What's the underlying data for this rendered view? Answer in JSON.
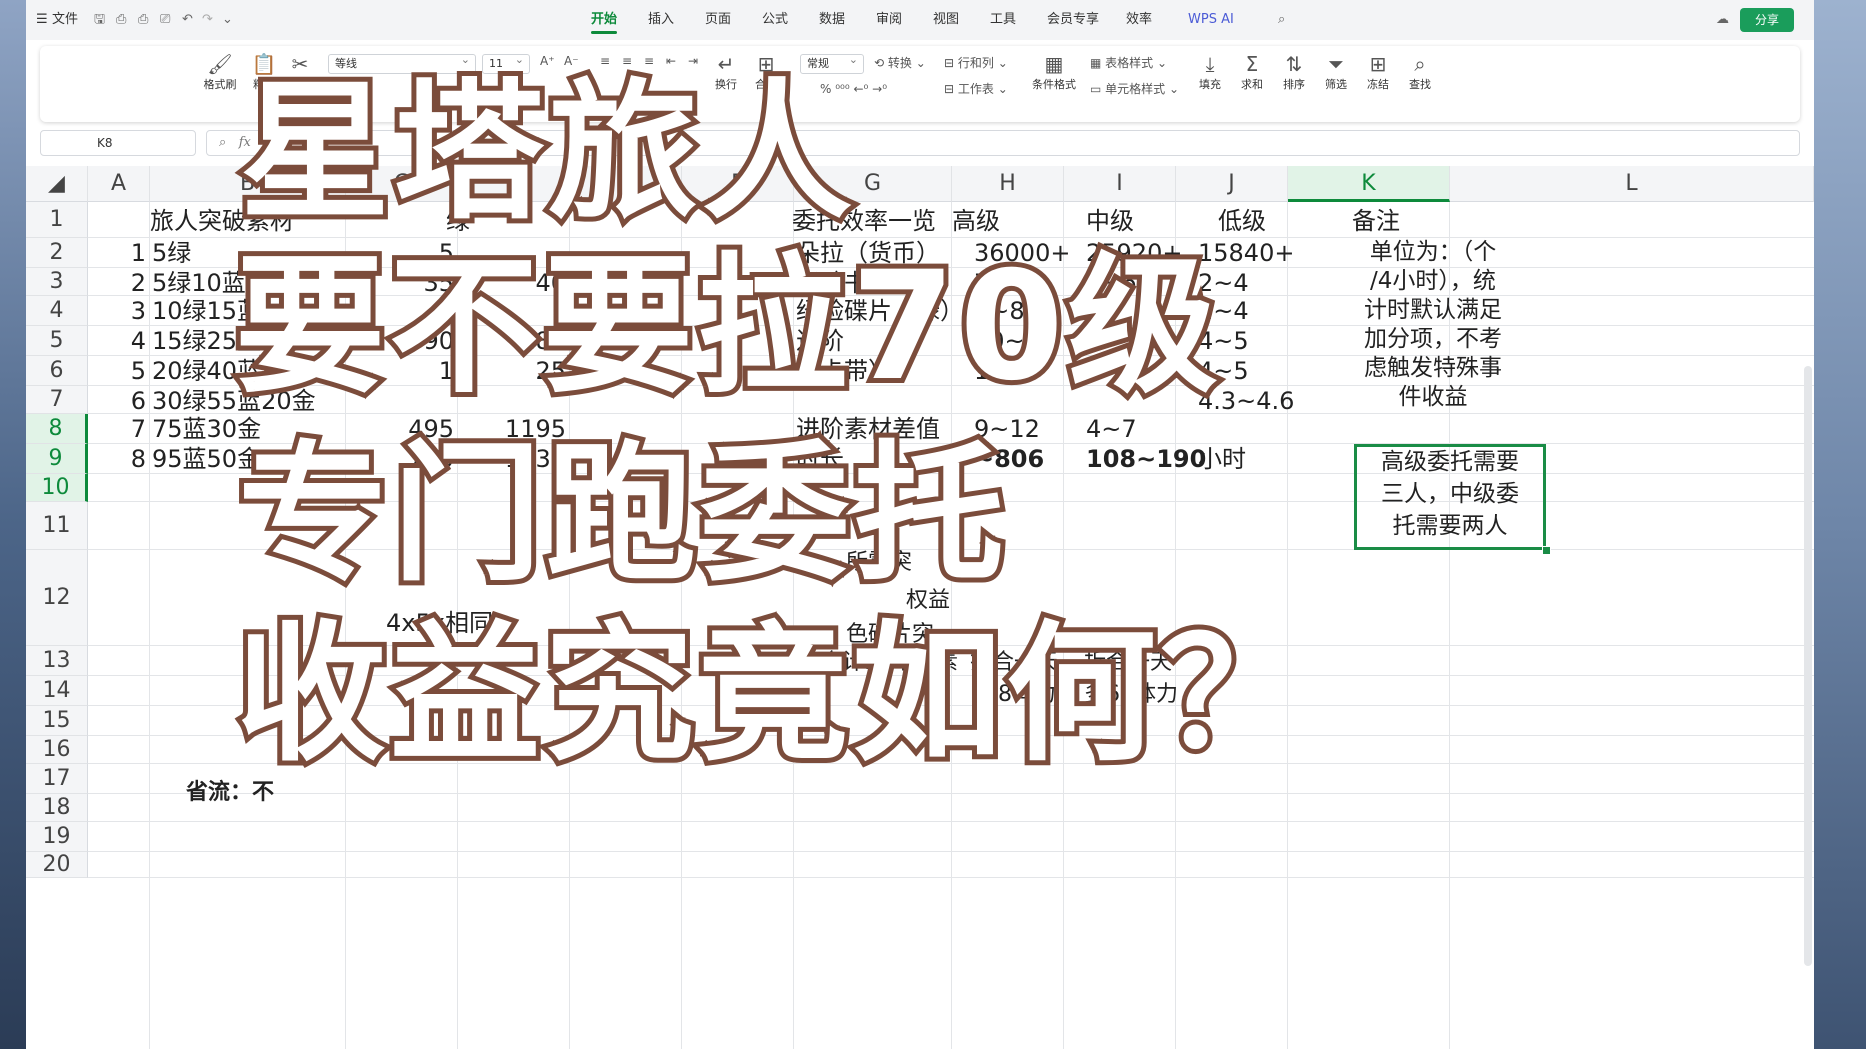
{
  "window": {
    "menu_file": "文件",
    "tabs": [
      {
        "label": "开始",
        "active": true
      },
      {
        "label": "插入"
      },
      {
        "label": "页面"
      },
      {
        "label": "公式"
      },
      {
        "label": "数据"
      },
      {
        "label": "审阅"
      },
      {
        "label": "视图"
      },
      {
        "label": "工具"
      },
      {
        "label": "会员专享"
      },
      {
        "label": "效率"
      },
      {
        "label": "WPS AI"
      }
    ],
    "share_label": "分享"
  },
  "ribbon": {
    "format_painter": "格式刷",
    "paste": "粘贴",
    "font_name": "等线",
    "font_size": "11",
    "wrap": "换行",
    "merge": "合并",
    "number_format": "常规",
    "convert": "转换",
    "row_col": "行和列",
    "sheet": "工作表",
    "table_style": "表格样式",
    "cond_format": "条件格式",
    "cell_style": "单元格样式",
    "fill": "填充",
    "sum": "求和",
    "sort": "排序",
    "filter": "筛选",
    "freeze": "冻结",
    "find": "查找"
  },
  "formula_bar": {
    "name_box": "K8",
    "fx": "fx",
    "content": "高"
  },
  "columns": [
    "A",
    "B",
    "C",
    "D",
    "E",
    "F",
    "G",
    "H",
    "I",
    "J",
    "K",
    "L"
  ],
  "rows": [
    "1",
    "2",
    "3",
    "4",
    "5",
    "6",
    "7",
    "8",
    "9",
    "10",
    "11",
    "12",
    "13",
    "14",
    "15",
    "16",
    "17",
    "18",
    "19",
    "20"
  ],
  "cells": {
    "b1": "旅人突破素材",
    "c1": "绿",
    "rows_ab": [
      [
        "1",
        "5绿"
      ],
      [
        "2",
        "5绿10蓝"
      ],
      [
        "3",
        "10绿15蓝"
      ],
      [
        "4",
        "15绿25蓝"
      ],
      [
        "5",
        "20绿40蓝"
      ],
      [
        "6",
        "30绿55蓝20金"
      ],
      [
        "7",
        "75蓝30金"
      ],
      [
        "8",
        "95蓝50金"
      ]
    ],
    "c_vals": [
      "5",
      "35",
      "",
      "90",
      "1",
      "",
      "495",
      "735"
    ],
    "d_vals": [
      "",
      "40",
      "",
      "185",
      "25",
      "",
      "1195",
      "1930"
    ],
    "c10": "4x5x相同",
    "g1": "委托效率一览",
    "h1": "高级",
    "i1": "中级",
    "j1": "低级",
    "k1": "备注",
    "g_rows": [
      "朵拉（货币）",
      "经验书（绿）",
      "经验碟片（绿）",
      "进阶",
      "（卡带）",
      "",
      "进阶素材差值",
      "时长"
    ],
    "h_rows": [
      "36000+",
      "7~8",
      "7~8",
      "10~",
      "12~",
      "",
      "9~12",
      "~806"
    ],
    "i_rows": [
      "25920+",
      "4~6",
      "",
      "",
      "",
      "",
      "4~7",
      "108~190"
    ],
    "j_rows": [
      "15840+",
      "2~4",
      "2~4",
      "4~5",
      "4~5",
      "4.3~4.6",
      "",
      "小时"
    ],
    "k_note1": [
      "单位为：（个",
      "/4小时），统",
      "计时默认满足",
      "加分项，不考",
      "虑触发特殊事",
      "件收益"
    ],
    "k_note2": [
      "高级委托需要",
      "三人，中级委",
      "托需要两人"
    ],
    "g12a": "所需突",
    "g12b": "权益",
    "g12c": "色碟片突",
    "g12d": "破合计32个绿素",
    "g12e": "材",
    "h12a": "折合一天",
    "h12b": "118体力",
    "i12a": "折合一天",
    "i12b": "多60体力",
    "b13": "省流：不"
  },
  "overlay": [
    "星塔旅人",
    "要不要拉70级",
    "专门跑委托",
    "收益究竟如何？"
  ]
}
